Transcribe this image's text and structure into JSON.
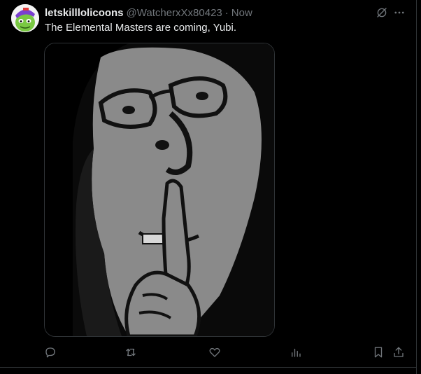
{
  "tweet": {
    "display_name": "letskilllolicoons",
    "handle": "@WatcherxXx80423",
    "separator": "·",
    "timestamp": "Now",
    "text": "The Elemental Masters are coming, Yubi."
  },
  "icons": {
    "grok": "grok-icon",
    "more": "more-icon",
    "reply": "reply-icon",
    "repost": "repost-icon",
    "like": "like-icon",
    "views": "views-icon",
    "bookmark": "bookmark-icon",
    "share": "share-icon"
  },
  "colors": {
    "background": "#000000",
    "primary_text": "#e7e9ea",
    "secondary_text": "#71767b",
    "border": "#2f3336",
    "avatar_green": "#7ac943",
    "avatar_purple": "#7b3fd1"
  }
}
